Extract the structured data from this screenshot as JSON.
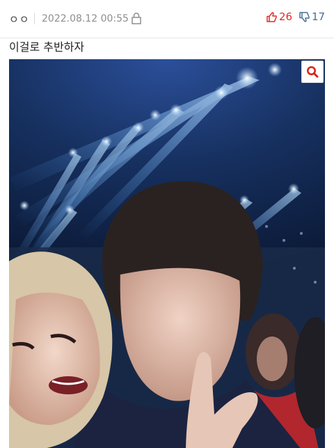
{
  "meta": {
    "author": "ㅇㅇ",
    "date": "2022.08.12 00:55",
    "upvotes": "26",
    "downvotes": "17"
  },
  "post": {
    "title": "이걸로 추반하자"
  },
  "colors": {
    "upvote": "#e02a2a",
    "downvote": "#4b6e96",
    "zoom": "#d9261c"
  },
  "icons": [
    "lock-icon",
    "thumbs-up-icon",
    "thumbs-down-icon",
    "zoom-icon"
  ]
}
